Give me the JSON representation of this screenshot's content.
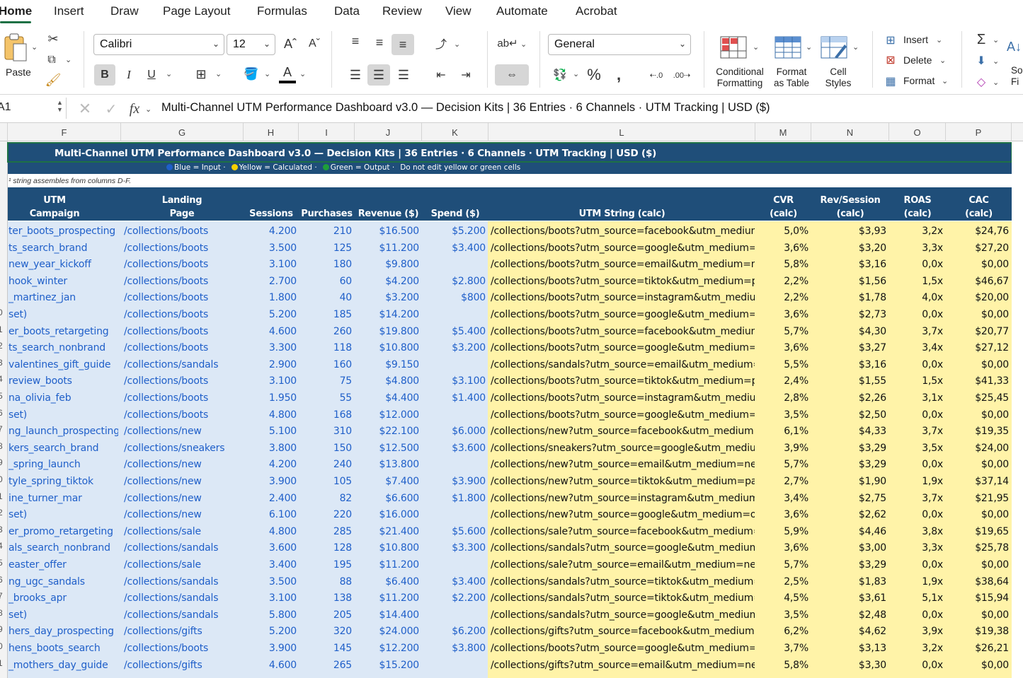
{
  "ribbon_tabs": [
    "Home",
    "Insert",
    "Draw",
    "Page Layout",
    "Formulas",
    "Data",
    "Review",
    "View",
    "Automate",
    "Acrobat"
  ],
  "ribbon": {
    "paste_label": "Paste",
    "font_name": "Calibri",
    "font_size": "12",
    "number_format": "General",
    "conditional_formatting": [
      "Conditional",
      "Formatting"
    ],
    "format_as_table": [
      "Format",
      "as Table"
    ],
    "cell_styles": [
      "Cell",
      "Styles"
    ],
    "insert_label": "Insert",
    "delete_label": "Delete",
    "format_label": "Format",
    "sort_label": [
      "So",
      "Fi"
    ]
  },
  "formula_bar": {
    "name_box": "A1",
    "fx": "fx",
    "content": "Multi-Channel UTM Performance Dashboard v3.0 — Decision Kits  |  36 Entries  ·  6 Channels  ·  UTM Tracking  |  USD ($)"
  },
  "columns": [
    "F",
    "G",
    "H",
    "I",
    "J",
    "K",
    "L",
    "M",
    "N",
    "O",
    "P"
  ],
  "sheet": {
    "title": "Multi-Channel UTM Performance Dashboard v3.0 — Decision Kits  |  36 Entries  ·  6 Channels  ·  UTM Tracking  |  USD ($)",
    "legend": {
      "blue": "Blue = Input  ·",
      "yellow": "Yellow = Calculated  ·",
      "green": "Green = Output  ·",
      "note": "Do not edit yellow or green cells",
      "blue_color": "#1f5fc9",
      "yellow_color": "#f5d000",
      "green_color": "#1e9e3a"
    },
    "string_note": "string assembles from columns D-F.",
    "headers": {
      "utm_campaign": [
        "UTM",
        "Campaign"
      ],
      "landing_page": [
        "Landing",
        "Page"
      ],
      "sessions": "Sessions",
      "purchases": "Purchases",
      "revenue": "Revenue ($)",
      "spend": "Spend ($)",
      "utm_string": "UTM String (calc)",
      "cvr": [
        "CVR",
        "(calc)"
      ],
      "rev_session": [
        "Rev/Session",
        "(calc)"
      ],
      "roas": [
        "ROAS",
        "(calc)"
      ],
      "cac": [
        "CAC",
        "(calc)"
      ]
    },
    "row_numbers": [
      "",
      "",
      "",
      "",
      "",
      "0",
      "1",
      "2",
      "3",
      "4",
      "5",
      "6",
      "7",
      "8",
      "9",
      "0",
      "1",
      "2",
      "3",
      "4",
      "5",
      "6",
      "7",
      "8",
      "9",
      "0",
      "1"
    ],
    "rows": [
      {
        "campaign": "ter_boots_prospecting",
        "landing": "/collections/boots",
        "sessions": "4.200",
        "purchases": "210",
        "revenue": "$16.500",
        "spend": "$5.200",
        "utm": "/collections/boots?utm_source=facebook&utm_medium=paid_",
        "cvr": "5,0%",
        "rps": "$3,93",
        "roas": "3,2x",
        "cac": "$24,76"
      },
      {
        "campaign": "ts_search_brand",
        "landing": "/collections/boots",
        "sessions": "3.500",
        "purchases": "125",
        "revenue": "$11.200",
        "spend": "$3.400",
        "utm": "/collections/boots?utm_source=google&utm_medium=paid_se",
        "cvr": "3,6%",
        "rps": "$3,20",
        "roas": "3,3x",
        "cac": "$27,20"
      },
      {
        "campaign": "new_year_kickoff",
        "landing": "/collections/boots",
        "sessions": "3.100",
        "purchases": "180",
        "revenue": "$9.800",
        "spend": "",
        "utm": "/collections/boots?utm_source=email&utm_medium=newslett",
        "cvr": "5,8%",
        "rps": "$3,16",
        "roas": "0,0x",
        "cac": "$0,00"
      },
      {
        "campaign": "hook_winter",
        "landing": "/collections/boots",
        "sessions": "2.700",
        "purchases": "60",
        "revenue": "$4.200",
        "spend": "$2.800",
        "utm": "/collections/boots?utm_source=tiktok&utm_medium=paid_so",
        "cvr": "2,2%",
        "rps": "$1,56",
        "roas": "1,5x",
        "cac": "$46,67"
      },
      {
        "campaign": "_martinez_jan",
        "landing": "/collections/boots",
        "sessions": "1.800",
        "purchases": "40",
        "revenue": "$3.200",
        "spend": "$800",
        "utm": "/collections/boots?utm_source=instagram&utm_medium=influ",
        "cvr": "2,2%",
        "rps": "$1,78",
        "roas": "4,0x",
        "cac": "$20,00"
      },
      {
        "campaign": "set)",
        "landing": "/collections/boots",
        "sessions": "5.200",
        "purchases": "185",
        "revenue": "$14.200",
        "spend": "",
        "utm": "/collections/boots?utm_source=google&utm_medium=organic",
        "cvr": "3,6%",
        "rps": "$2,73",
        "roas": "0,0x",
        "cac": "$0,00"
      },
      {
        "campaign": "er_boots_retargeting",
        "landing": "/collections/boots",
        "sessions": "4.600",
        "purchases": "260",
        "revenue": "$19.800",
        "spend": "$5.400",
        "utm": "/collections/boots?utm_source=facebook&utm_medium=paid_",
        "cvr": "5,7%",
        "rps": "$4,30",
        "roas": "3,7x",
        "cac": "$20,77"
      },
      {
        "campaign": "ts_search_nonbrand",
        "landing": "/collections/boots",
        "sessions": "3.300",
        "purchases": "118",
        "revenue": "$10.800",
        "spend": "$3.200",
        "utm": "/collections/boots?utm_source=google&utm_medium=paid_se",
        "cvr": "3,6%",
        "rps": "$3,27",
        "roas": "3,4x",
        "cac": "$27,12"
      },
      {
        "campaign": "valentines_gift_guide",
        "landing": "/collections/sandals",
        "sessions": "2.900",
        "purchases": "160",
        "revenue": "$9.150",
        "spend": "",
        "utm": "/collections/sandals?utm_source=email&utm_medium=newsle",
        "cvr": "5,5%",
        "rps": "$3,16",
        "roas": "0,0x",
        "cac": "$0,00"
      },
      {
        "campaign": "review_boots",
        "landing": "/collections/boots",
        "sessions": "3.100",
        "purchases": "75",
        "revenue": "$4.800",
        "spend": "$3.100",
        "utm": "/collections/boots?utm_source=tiktok&utm_medium=paid_so",
        "cvr": "2,4%",
        "rps": "$1,55",
        "roas": "1,5x",
        "cac": "$41,33"
      },
      {
        "campaign": "na_olivia_feb",
        "landing": "/collections/boots",
        "sessions": "1.950",
        "purchases": "55",
        "revenue": "$4.400",
        "spend": "$1.400",
        "utm": "/collections/boots?utm_source=instagram&utm_medium=influ",
        "cvr": "2,8%",
        "rps": "$2,26",
        "roas": "3,1x",
        "cac": "$25,45"
      },
      {
        "campaign": "set)",
        "landing": "/collections/boots",
        "sessions": "4.800",
        "purchases": "168",
        "revenue": "$12.000",
        "spend": "",
        "utm": "/collections/boots?utm_source=google&utm_medium=organic",
        "cvr": "3,5%",
        "rps": "$2,50",
        "roas": "0,0x",
        "cac": "$0,00"
      },
      {
        "campaign": "ng_launch_prospecting",
        "landing": "/collections/new",
        "sessions": "5.100",
        "purchases": "310",
        "revenue": "$22.100",
        "spend": "$6.000",
        "utm": "/collections/new?utm_source=facebook&utm_medium=paid_s",
        "cvr": "6,1%",
        "rps": "$4,33",
        "roas": "3,7x",
        "cac": "$19,35"
      },
      {
        "campaign": "kers_search_brand",
        "landing": "/collections/sneakers",
        "sessions": "3.800",
        "purchases": "150",
        "revenue": "$12.500",
        "spend": "$3.600",
        "utm": "/collections/sneakers?utm_source=google&utm_medium=paid",
        "cvr": "3,9%",
        "rps": "$3,29",
        "roas": "3,5x",
        "cac": "$24,00"
      },
      {
        "campaign": "_spring_launch",
        "landing": "/collections/new",
        "sessions": "4.200",
        "purchases": "240",
        "revenue": "$13.800",
        "spend": "",
        "utm": "/collections/new?utm_source=email&utm_medium=newslette",
        "cvr": "5,7%",
        "rps": "$3,29",
        "roas": "0,0x",
        "cac": "$0,00"
      },
      {
        "campaign": "tyle_spring_tiktok",
        "landing": "/collections/new",
        "sessions": "3.900",
        "purchases": "105",
        "revenue": "$7.400",
        "spend": "$3.900",
        "utm": "/collections/new?utm_source=tiktok&utm_medium=paid_soci",
        "cvr": "2,7%",
        "rps": "$1,90",
        "roas": "1,9x",
        "cac": "$37,14"
      },
      {
        "campaign": "ine_turner_mar",
        "landing": "/collections/new",
        "sessions": "2.400",
        "purchases": "82",
        "revenue": "$6.600",
        "spend": "$1.800",
        "utm": "/collections/new?utm_source=instagram&utm_medium=influe",
        "cvr": "3,4%",
        "rps": "$2,75",
        "roas": "3,7x",
        "cac": "$21,95"
      },
      {
        "campaign": "set)",
        "landing": "/collections/new",
        "sessions": "6.100",
        "purchases": "220",
        "revenue": "$16.000",
        "spend": "",
        "utm": "/collections/new?utm_source=google&utm_medium=organic&",
        "cvr": "3,6%",
        "rps": "$2,62",
        "roas": "0,0x",
        "cac": "$0,00"
      },
      {
        "campaign": "er_promo_retargeting",
        "landing": "/collections/sale",
        "sessions": "4.800",
        "purchases": "285",
        "revenue": "$21.400",
        "spend": "$5.600",
        "utm": "/collections/sale?utm_source=facebook&utm_medium=paid_s",
        "cvr": "5,9%",
        "rps": "$4,46",
        "roas": "3,8x",
        "cac": "$19,65"
      },
      {
        "campaign": "als_search_nonbrand",
        "landing": "/collections/sandals",
        "sessions": "3.600",
        "purchases": "128",
        "revenue": "$10.800",
        "spend": "$3.300",
        "utm": "/collections/sandals?utm_source=google&utm_medium=paid_",
        "cvr": "3,6%",
        "rps": "$3,00",
        "roas": "3,3x",
        "cac": "$25,78"
      },
      {
        "campaign": "easter_offer",
        "landing": "/collections/sale",
        "sessions": "3.400",
        "purchases": "195",
        "revenue": "$11.200",
        "spend": "",
        "utm": "/collections/sale?utm_source=email&utm_medium=newsletter",
        "cvr": "5,7%",
        "rps": "$3,29",
        "roas": "0,0x",
        "cac": "$0,00"
      },
      {
        "campaign": "ng_ugc_sandals",
        "landing": "/collections/sandals",
        "sessions": "3.500",
        "purchases": "88",
        "revenue": "$6.400",
        "spend": "$3.400",
        "utm": "/collections/sandals?utm_source=tiktok&utm_medium=paid_s",
        "cvr": "2,5%",
        "rps": "$1,83",
        "roas": "1,9x",
        "cac": "$38,64"
      },
      {
        "campaign": "_brooks_apr",
        "landing": "/collections/sandals",
        "sessions": "3.100",
        "purchases": "138",
        "revenue": "$11.200",
        "spend": "$2.200",
        "utm": "/collections/sandals?utm_source=tiktok&utm_medium=influer",
        "cvr": "4,5%",
        "rps": "$3,61",
        "roas": "5,1x",
        "cac": "$15,94"
      },
      {
        "campaign": "set)",
        "landing": "/collections/sandals",
        "sessions": "5.800",
        "purchases": "205",
        "revenue": "$14.400",
        "spend": "",
        "utm": "/collections/sandals?utm_source=google&utm_medium=organ",
        "cvr": "3,5%",
        "rps": "$2,48",
        "roas": "0,0x",
        "cac": "$0,00"
      },
      {
        "campaign": "hers_day_prospecting",
        "landing": "/collections/gifts",
        "sessions": "5.200",
        "purchases": "320",
        "revenue": "$24.000",
        "spend": "$6.200",
        "utm": "/collections/gifts?utm_source=facebook&utm_medium=paid_s",
        "cvr": "6,2%",
        "rps": "$4,62",
        "roas": "3,9x",
        "cac": "$19,38"
      },
      {
        "campaign": "hens_boots_search",
        "landing": "/collections/boots",
        "sessions": "3.900",
        "purchases": "145",
        "revenue": "$12.200",
        "spend": "$3.800",
        "utm": "/collections/boots?utm_source=google&utm_medium=paid_se",
        "cvr": "3,7%",
        "rps": "$3,13",
        "roas": "3,2x",
        "cac": "$26,21"
      },
      {
        "campaign": "_mothers_day_guide",
        "landing": "/collections/gifts",
        "sessions": "4.600",
        "purchases": "265",
        "revenue": "$15.200",
        "spend": "",
        "utm": "/collections/gifts?utm_source=email&utm_medium=newslette",
        "cvr": "5,8%",
        "rps": "$3,30",
        "roas": "0,0x",
        "cac": "$0,00"
      }
    ]
  }
}
